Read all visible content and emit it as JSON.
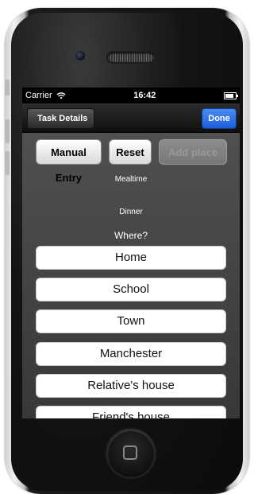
{
  "status_bar": {
    "carrier": "Carrier",
    "time": "16:42"
  },
  "nav": {
    "back_label": "Task Details",
    "done_label": "Done"
  },
  "buttons": {
    "manual_entry": "Manual Entry",
    "reset": "Reset",
    "add_place": "Add place"
  },
  "labels": {
    "category": "Mealtime",
    "selection": "Dinner",
    "question": "Where?"
  },
  "options": [
    "Home",
    "School",
    "Town",
    "Manchester",
    "Relative's house",
    "Friend's house"
  ]
}
